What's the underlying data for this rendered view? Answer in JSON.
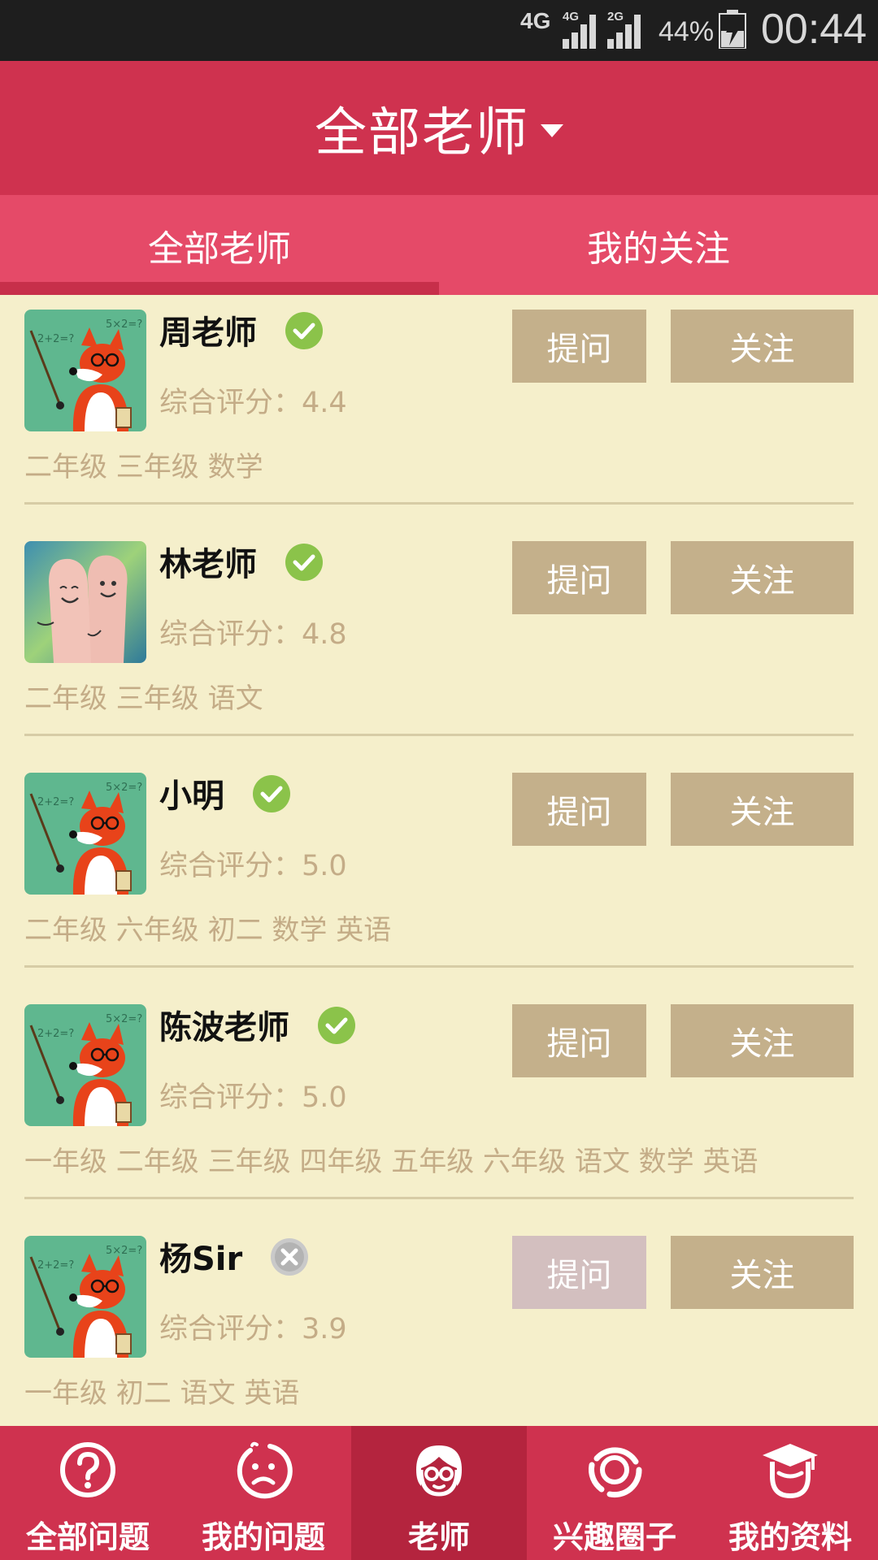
{
  "status_bar": {
    "network": "4G",
    "sim1_label": "4G",
    "sim2_label": "2G",
    "battery": "44%",
    "time": "00:44"
  },
  "header": {
    "title": "全部老师"
  },
  "tabs": [
    {
      "label": "全部老师",
      "active": true
    },
    {
      "label": "我的关注",
      "active": false
    }
  ],
  "teachers": [
    {
      "name": "周老师",
      "verified": true,
      "rating": "综合评分：4.4",
      "tags": "二年级 三年级 数学",
      "ask_label": "提问",
      "follow_label": "关注",
      "ask_enabled": true,
      "avatar": "fox-teacher"
    },
    {
      "name": "林老师",
      "verified": true,
      "rating": "综合评分：4.8",
      "tags": "二年级 三年级 语文",
      "ask_label": "提问",
      "follow_label": "关注",
      "ask_enabled": true,
      "avatar": "finger-faces-photo"
    },
    {
      "name": "小明",
      "verified": true,
      "rating": "综合评分：5.0",
      "tags": "二年级 六年级 初二 数学 英语",
      "ask_label": "提问",
      "follow_label": "关注",
      "ask_enabled": true,
      "avatar": "fox-teacher"
    },
    {
      "name": "陈波老师",
      "verified": true,
      "rating": "综合评分：5.0",
      "tags": "一年级 二年级 三年级 四年级 五年级 六年级 语文 数学 英语",
      "ask_label": "提问",
      "follow_label": "关注",
      "ask_enabled": true,
      "avatar": "fox-teacher"
    },
    {
      "name": "杨Sir",
      "verified": false,
      "rating": "综合评分：3.9",
      "tags": "一年级 初二 语文 英语",
      "ask_label": "提问",
      "follow_label": "关注",
      "ask_enabled": false,
      "avatar": "fox-teacher"
    }
  ],
  "bottom_nav": [
    {
      "label": "全部问题",
      "icon": "question-circle-icon",
      "active": false
    },
    {
      "label": "我的问题",
      "icon": "confused-face-icon",
      "active": false
    },
    {
      "label": "老师",
      "icon": "teacher-face-icon",
      "active": true
    },
    {
      "label": "兴趣圈子",
      "icon": "circle-ring-icon",
      "active": false
    },
    {
      "label": "我的资料",
      "icon": "graduate-cap-icon",
      "active": false
    }
  ],
  "colors": {
    "primary": "#cf324f",
    "tab_bar": "#e54a68",
    "background": "#f5efcb",
    "button": "#c4b08b",
    "button_disabled": "#d3bfbf",
    "muted_text": "#c4ac87",
    "verified": "#8bc34a"
  }
}
